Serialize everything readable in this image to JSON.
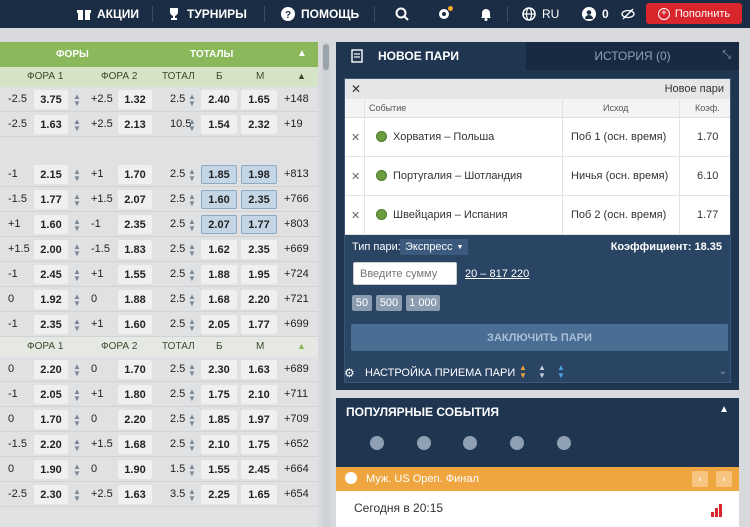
{
  "nav": {
    "items": [
      {
        "label": "АКЦИИ",
        "icon": "gift-icon"
      },
      {
        "label": "ТУРНИРЫ",
        "icon": "trophy-icon"
      },
      {
        "label": "ПОМОЩЬ",
        "icon": "help-icon"
      }
    ],
    "lang": "RU",
    "balance": "0",
    "topup_label": "Пополнить"
  },
  "odds_table": {
    "group_forы": "ФОРЫ",
    "group_totals": "ТОТАЛЫ",
    "cols": [
      "ФОРА 1",
      "ФОРА 2",
      "ТОТАЛ",
      "Б",
      "М"
    ],
    "rows_top": [
      {
        "h1": "-2.5",
        "o1": "3.75",
        "h2": "+2.5",
        "o2": "1.32",
        "t": "2.5",
        "b": "2.40",
        "m": "1.65",
        "more": "+148"
      },
      {
        "h1": "-2.5",
        "o1": "1.63",
        "h2": "+2.5",
        "o2": "2.13",
        "t": "10.5",
        "b": "1.54",
        "m": "2.32",
        "more": "+19"
      }
    ],
    "rows_mid": [
      {
        "h1": "-1",
        "o1": "2.15",
        "h2": "+1",
        "o2": "1.70",
        "t": "2.5",
        "b": "1.85",
        "m": "1.98",
        "more": "+813"
      },
      {
        "h1": "-1.5",
        "o1": "1.77",
        "h2": "+1.5",
        "o2": "2.07",
        "t": "2.5",
        "b": "1.60",
        "m": "2.35",
        "more": "+766"
      },
      {
        "h1": "+1",
        "o1": "1.60",
        "h2": "-1",
        "o2": "2.35",
        "t": "2.5",
        "b": "2.07",
        "m": "1.77",
        "more": "+803"
      },
      {
        "h1": "+1.5",
        "o1": "2.00",
        "h2": "-1.5",
        "o2": "1.83",
        "t": "2.5",
        "b": "1.62",
        "m": "2.35",
        "more": "+669"
      },
      {
        "h1": "-1",
        "o1": "2.45",
        "h2": "+1",
        "o2": "1.55",
        "t": "2.5",
        "b": "1.88",
        "m": "1.95",
        "more": "+724"
      },
      {
        "h1": "0",
        "o1": "1.92",
        "h2": "0",
        "o2": "1.88",
        "t": "2.5",
        "b": "1.68",
        "m": "2.20",
        "more": "+721"
      },
      {
        "h1": "-1",
        "o1": "2.35",
        "h2": "+1",
        "o2": "1.60",
        "t": "2.5",
        "b": "2.05",
        "m": "1.77",
        "more": "+699"
      }
    ],
    "rows_bottom": [
      {
        "h1": "0",
        "o1": "2.20",
        "h2": "0",
        "o2": "1.70",
        "t": "2.5",
        "b": "2.30",
        "m": "1.63",
        "more": "+689"
      },
      {
        "h1": "-1",
        "o1": "2.05",
        "h2": "+1",
        "o2": "1.80",
        "t": "2.5",
        "b": "1.75",
        "m": "2.10",
        "more": "+711"
      },
      {
        "h1": "0",
        "o1": "1.70",
        "h2": "0",
        "o2": "2.20",
        "t": "2.5",
        "b": "1.85",
        "m": "1.97",
        "more": "+709"
      },
      {
        "h1": "-1.5",
        "o1": "2.20",
        "h2": "+1.5",
        "o2": "1.68",
        "t": "2.5",
        "b": "2.10",
        "m": "1.75",
        "more": "+652"
      },
      {
        "h1": "0",
        "o1": "1.90",
        "h2": "0",
        "o2": "1.90",
        "t": "1.5",
        "b": "1.55",
        "m": "2.45",
        "more": "+664"
      },
      {
        "h1": "-2.5",
        "o1": "2.30",
        "h2": "+2.5",
        "o2": "1.63",
        "t": "3.5",
        "b": "2.25",
        "m": "1.65",
        "more": "+654"
      }
    ]
  },
  "betslip": {
    "tab_new": "НОВОЕ ПАРИ",
    "tab_history": "ИСТОРИЯ (0)",
    "box_title": "Новое пари",
    "th_event": "Событие",
    "th_outcome": "Исход",
    "th_coef": "Коэф.",
    "bets": [
      {
        "event": "Хорватия – Польша",
        "outcome": "Поб 1 (осн. время)",
        "coef": "1.70"
      },
      {
        "event": "Португалия – Шотландия",
        "outcome": "Ничья (осн. время)",
        "coef": "6.10"
      },
      {
        "event": "Швейцария – Испания",
        "outcome": "Поб 2 (осн. время)",
        "coef": "1.77"
      }
    ],
    "type_label": "Тип пари:",
    "type_value": "Экспресс",
    "total_coef_label": "Коэффициент:",
    "total_coef": "18.35",
    "sum_placeholder": "Введите сумму",
    "range_min": "20",
    "range_sep": " – ",
    "range_max": "817 220",
    "chips": [
      "50",
      "500",
      "1 000"
    ],
    "place_label": "ЗАКЛЮЧИТЬ ПАРИ"
  },
  "settings": {
    "label": "НАСТРОЙКА ПРИЕМА ПАРИ"
  },
  "popular": {
    "title": "ПОПУЛЯРНЫЕ СОБЫТИЯ",
    "final_label": "Муж. US Open. Финал",
    "today_label": "Сегодня в 20:15"
  }
}
